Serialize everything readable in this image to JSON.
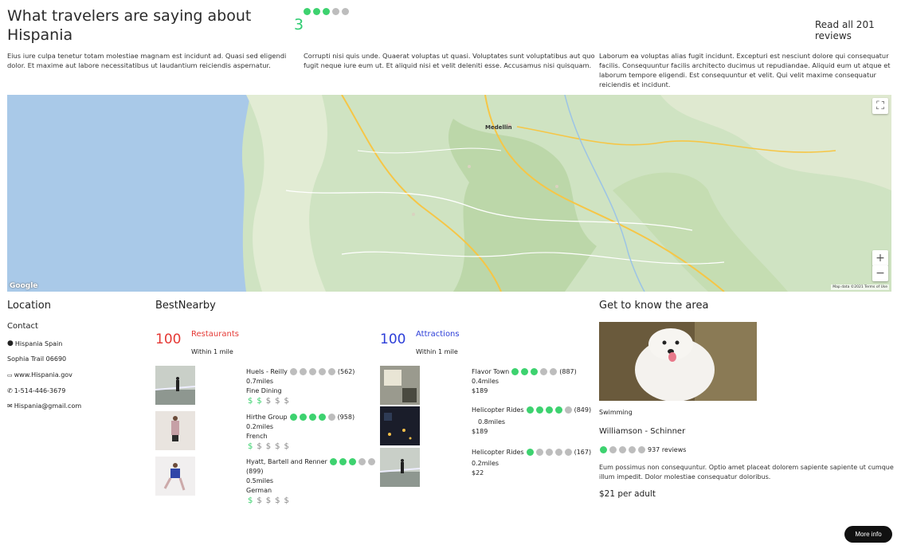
{
  "hero": {
    "title": "What travelers are saying about Hispania",
    "score": "3",
    "rating_filled": 3,
    "rating_total": 5,
    "read_all": "Read all 201 reviews"
  },
  "blurbs": [
    "Eius iure culpa tenetur totam molestiae magnam est incidunt ad. Quasi sed eligendi dolor. Et maxime aut labore necessitatibus ut laudantium reiciendis aspernatur.",
    "Corrupti nisi quis unde. Quaerat voluptas ut quasi. Voluptates sunt voluptatibus aut quo fugit neque iure eum ut. Et aliquid nisi et velit deleniti esse. Accusamus nisi quisquam.",
    "Laborum ea voluptas alias fugit incidunt. Excepturi est nesciunt dolore qui consequatur facilis. Consequuntur facilis architecto ducimus ut repudiandae. Aliquid eum ut atque et laborum tempore eligendi. Est consequuntur et velit. Qui velit maxime consequatur reiciendis et incidunt."
  ],
  "map": {
    "city_label": "Medellin",
    "zoom_in": "+",
    "zoom_out": "−",
    "google": "Google",
    "attribution": "Map data ©2021   Terms of Use"
  },
  "location": {
    "title": "Location",
    "contact_title": "Contact",
    "name": "Hispania Spain",
    "address": "Sophia Trail 06690",
    "website": "www.Hispania.gov",
    "phone": "1-514-446-3679",
    "email": "Hispania@gmail.com"
  },
  "nearby": {
    "title": "BestNearby",
    "restaurants": {
      "count": "100",
      "label": "Restaurants",
      "within": "Within 1 mile",
      "items": [
        {
          "name": "Huels - Reilly",
          "rating": 0,
          "reviews": "(562)",
          "distance": "0.7miles",
          "category": "Fine Dining",
          "price_level": 2
        },
        {
          "name": "Hirthe Group",
          "rating": 4,
          "reviews": "(958)",
          "distance": "0.2miles",
          "category": "French",
          "price_level": 1
        },
        {
          "name": "Hyatt, Bartell and Renner",
          "rating": 3,
          "reviews": "(899)",
          "distance": "0.5miles",
          "category": "German",
          "price_level": 1
        }
      ]
    },
    "attractions": {
      "count": "100",
      "label": "Attractions",
      "within": "Within 1 mile",
      "items": [
        {
          "name": "Flavor Town",
          "rating": 3,
          "reviews": "(887)",
          "distance": "0.4miles",
          "price": "$189"
        },
        {
          "name": "Helicopter Rides",
          "rating": 4,
          "reviews": "(849)",
          "distance": "0.8miles",
          "price": "$189"
        },
        {
          "name": "Helicopter Rides",
          "rating": 1,
          "reviews": "(167)",
          "distance": "0.2miles",
          "price": "$22"
        }
      ]
    }
  },
  "area": {
    "title": "Get to know the area",
    "activity": "Swimming",
    "name": "Williamson - Schinner",
    "rating": 1,
    "reviews": "937 reviews",
    "description": "Eum possimus non consequuntur. Optio amet placeat dolorem sapiente sapiente ut cumque illum impedit. Dolor molestiae consequatur doloribus.",
    "price": "$21 per adult"
  },
  "more_info": "More info",
  "colors": {
    "accent_green": "#3dd26f",
    "count_red": "#e53935",
    "restaurants_red": "#e53935",
    "attractions_blue": "#2c3ed8"
  }
}
